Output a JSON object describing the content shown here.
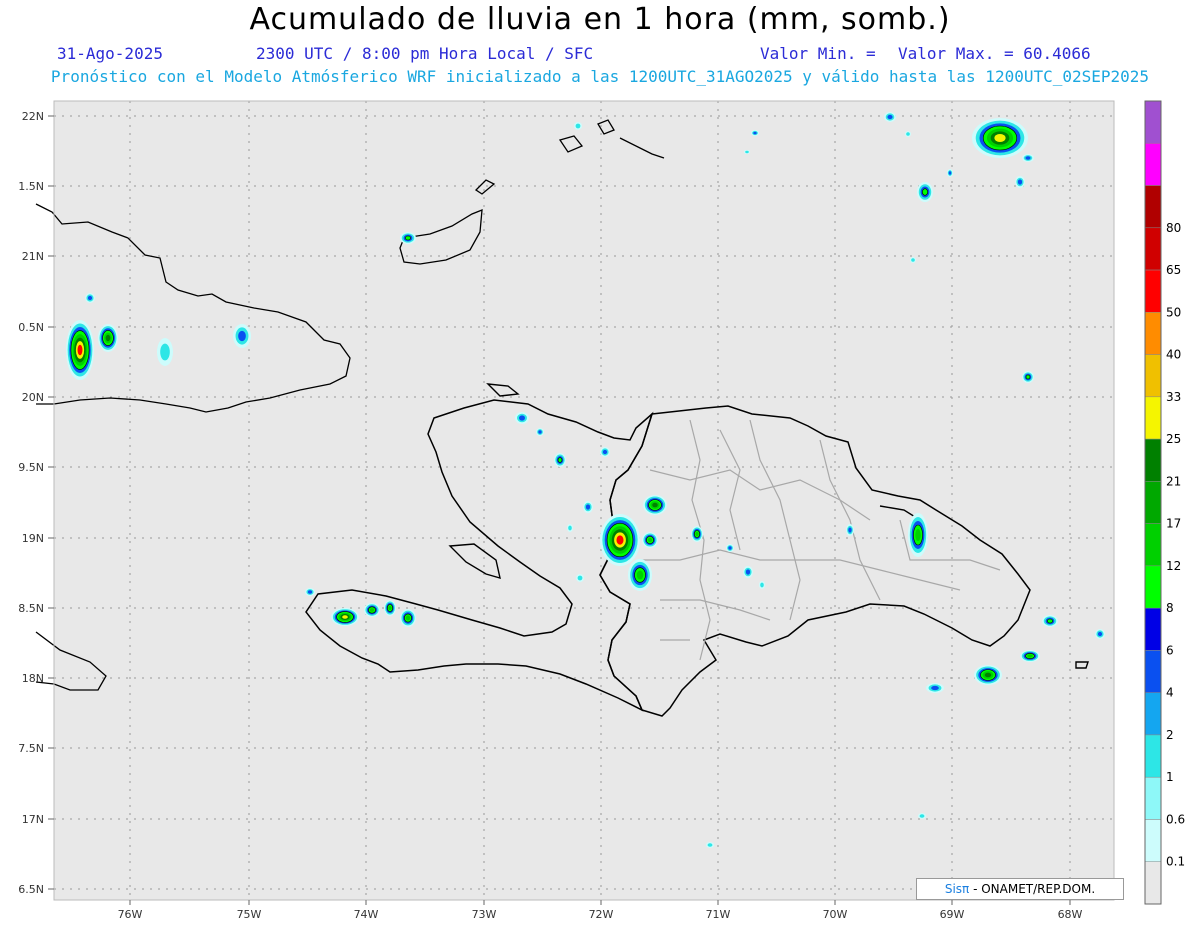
{
  "header": {
    "title": "Acumulado de lluvia en 1 hora (mm, somb.)",
    "date": "31-Ago-2025",
    "time": "2300 UTC / 8:00 pm Hora Local / SFC",
    "min_label": "Valor Min. =",
    "max_label": "Valor Max. = 60.4066",
    "forecast": "Pronóstico con el Modelo Atmósferico WRF inicializado a las 1200UTC_31AGO2025 y válido hasta las  1200UTC_02SEP2025"
  },
  "axes": {
    "lon_labels": [
      "76W",
      "75W",
      "74W",
      "73W",
      "72W",
      "71W",
      "70W",
      "69W",
      "68W"
    ],
    "lat_labels": [
      "22N",
      "1.5N",
      "21N",
      "0.5N",
      "20N",
      "9.5N",
      "19N",
      "8.5N",
      "18N",
      "7.5N",
      "17N",
      "6.5N"
    ]
  },
  "colorbar": {
    "levels": [
      "0.1",
      "0.6",
      "1",
      "2",
      "4",
      "6",
      "8",
      "12",
      "17",
      "21",
      "25",
      "33",
      "40",
      "50",
      "65",
      "80"
    ],
    "colors": [
      "#e8e8e8",
      "#cdfcfc",
      "#8ef8f8",
      "#2de6e6",
      "#14a6f0",
      "#0a50f0",
      "#0000e6",
      "#00ff00",
      "#00d000",
      "#00a800",
      "#008000",
      "#f5f500",
      "#f0c000",
      "#ff8c00",
      "#ff0000",
      "#d00000",
      "#b00000",
      "#ff00ff",
      "#a050d0"
    ]
  },
  "credit": {
    "sis": "Sis",
    "pi": "π",
    "rest": " - ONAMET/REP.DOM."
  }
}
